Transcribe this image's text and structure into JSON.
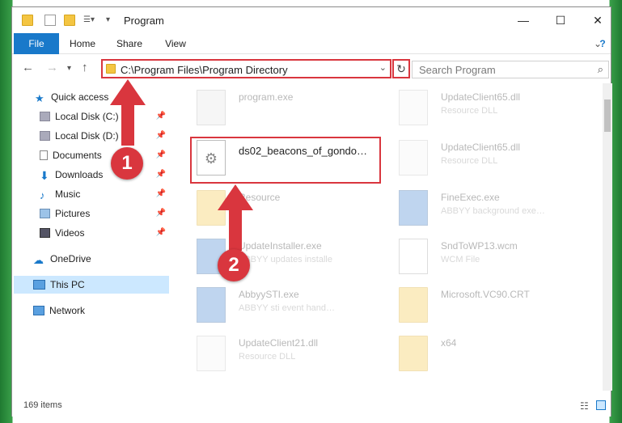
{
  "window": {
    "title": "Program",
    "controls": {
      "minimize": "—",
      "maximize": "☐",
      "close": "✕"
    }
  },
  "ribbon": {
    "tabs": [
      {
        "label": "File"
      },
      {
        "label": "Home"
      },
      {
        "label": "Share"
      },
      {
        "label": "View"
      }
    ]
  },
  "nav": {
    "address": "C:\\Program Files\\Program Directory",
    "search_placeholder": "Search Program"
  },
  "sidebar": {
    "quick_access": "Quick access",
    "items": [
      {
        "label": "Local Disk (C:)"
      },
      {
        "label": "Local Disk (D:)"
      },
      {
        "label": "Documents"
      },
      {
        "label": "Downloads"
      },
      {
        "label": "Music"
      },
      {
        "label": "Pictures"
      },
      {
        "label": "Videos"
      }
    ],
    "onedrive": "OneDrive",
    "thispc": "This PC",
    "network": "Network"
  },
  "files": {
    "program": {
      "name": "program.exe",
      "sub": ""
    },
    "highlighted": {
      "name": "ds02_beacons_of_gondo…",
      "sub": ""
    },
    "resource": {
      "name": "Resource",
      "sub": ""
    },
    "updateinstaller": {
      "name": "UpdateInstaller.exe",
      "sub": "ABBYY updates installe"
    },
    "abbyysti": {
      "name": "AbbyySTI.exe",
      "sub": "ABBYY sti event hand…"
    },
    "updateclient21": {
      "name": "UpdateClient21.dll",
      "sub": "Resource DLL"
    },
    "updateclient65a": {
      "name": "UpdateClient65.dll",
      "sub": "Resource DLL"
    },
    "updateclient65b": {
      "name": "UpdateClient65.dll",
      "sub": "Resource DLL"
    },
    "fineexec": {
      "name": "FineExec.exe",
      "sub": "ABBYY background exe…"
    },
    "sndtowp": {
      "name": "SndToWP13.wcm",
      "sub": "WCM File"
    },
    "vc90": {
      "name": "Microsoft.VC90.CRT",
      "sub": ""
    },
    "x64": {
      "name": "x64",
      "sub": ""
    }
  },
  "status": {
    "count": "169 items"
  },
  "badges": {
    "one": "1",
    "two": "2"
  },
  "colors": {
    "accent": "#1979ca",
    "highlight": "#d9363e",
    "selected": "#cce8ff"
  }
}
